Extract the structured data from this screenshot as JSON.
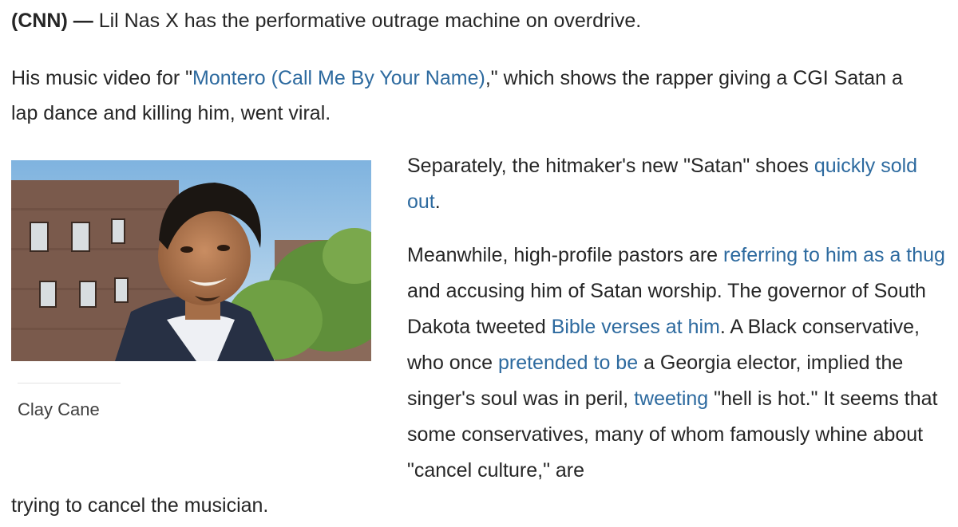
{
  "lead": {
    "dateline": "(CNN) —",
    "text": " Lil Nas X has the performative outrage machine on overdrive."
  },
  "para2": {
    "before": "His music video for \"",
    "link": "Montero (Call Me By Your Name)",
    "after": ",\" which shows the rapper giving a CGI Satan a lap dance and killing him, went viral."
  },
  "figure": {
    "caption": "Clay Cane"
  },
  "para3": {
    "before": "Separately, the hitmaker's new \"Satan\" shoes ",
    "link": "quickly sold out",
    "after": "."
  },
  "para4": {
    "t1": "Meanwhile, high-profile pastors are ",
    "l1": "referring to him as a thug",
    "t2": " and accusing him of Satan worship. The governor of South Dakota tweeted ",
    "l2": "Bible verses at him",
    "t3": ". A Black conservative, who once ",
    "l3": "pretended to be",
    "t4": " a Georgia elector, implied the singer's soul was in peril, ",
    "l4": "tweeting",
    "t5": " \"hell is hot.\" It seems that some conservatives, many of whom famously whine about \"cancel culture,\" are",
    "t6": "trying to cancel the musician."
  },
  "colors": {
    "text": "#262626",
    "link": "#2d6a9f",
    "caption": "#404040"
  }
}
